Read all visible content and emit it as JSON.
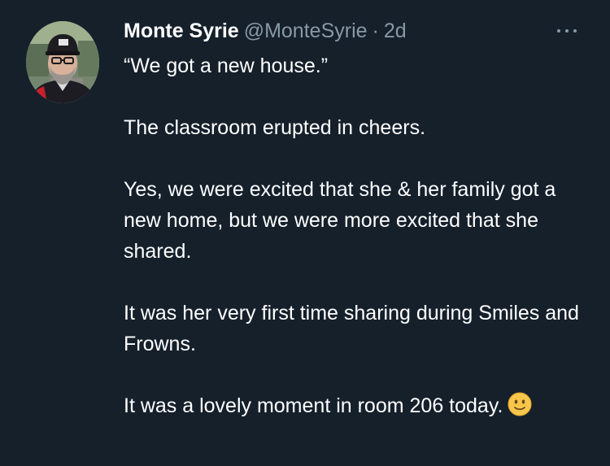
{
  "tweet": {
    "author": {
      "display_name": "Monte Syrie",
      "handle": "@MonteSyrie",
      "separator": "·",
      "timestamp": "2d",
      "avatar_icon": "profile-photo"
    },
    "menu_icon": "more-options-icon",
    "paragraphs": [
      "“We got a new house.”",
      "The classroom erupted in cheers.",
      "Yes, we were excited that she & her family got a new home, but we were more excited that she shared.",
      "It was her very first time sharing during Smiles and Frowns.",
      "It was a lovely moment in room 206 today."
    ],
    "emoji": "slightly-smiling-face-emoji"
  },
  "colors": {
    "background": "#15202b",
    "text_primary": "#ffffff",
    "text_secondary": "#8899a6",
    "emoji_face": "#f7c64a"
  }
}
